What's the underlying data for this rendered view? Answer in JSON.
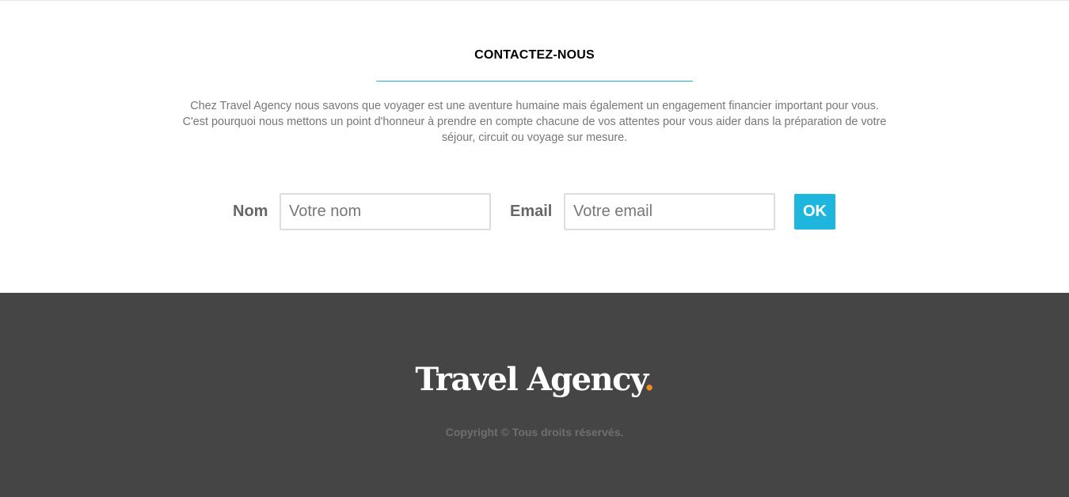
{
  "contact": {
    "title": "CONTACTEZ-NOUS",
    "intro_line1": "Chez Travel Agency nous savons que voyager est une aventure humaine mais également un engagement financier important pour vous.",
    "intro_line2": "C'est pourquoi nous mettons un point d'honneur à prendre en compte chacune de vos attentes pour vous aider dans la préparation de votre",
    "intro_line3": "séjour, circuit ou voyage sur mesure.",
    "form": {
      "name_label": "Nom",
      "name_placeholder": "Votre nom",
      "name_value": "",
      "email_label": "Email",
      "email_placeholder": "Votre email",
      "email_value": "",
      "submit_label": "OK"
    }
  },
  "footer": {
    "brand": "Travel Agency",
    "brand_dot": ".",
    "copyright": "Copyright © Tous droits réservés."
  },
  "colors": {
    "accent": "#1fb6dd",
    "brand_dot": "#f08b1c",
    "footer_bg": "#454545"
  }
}
